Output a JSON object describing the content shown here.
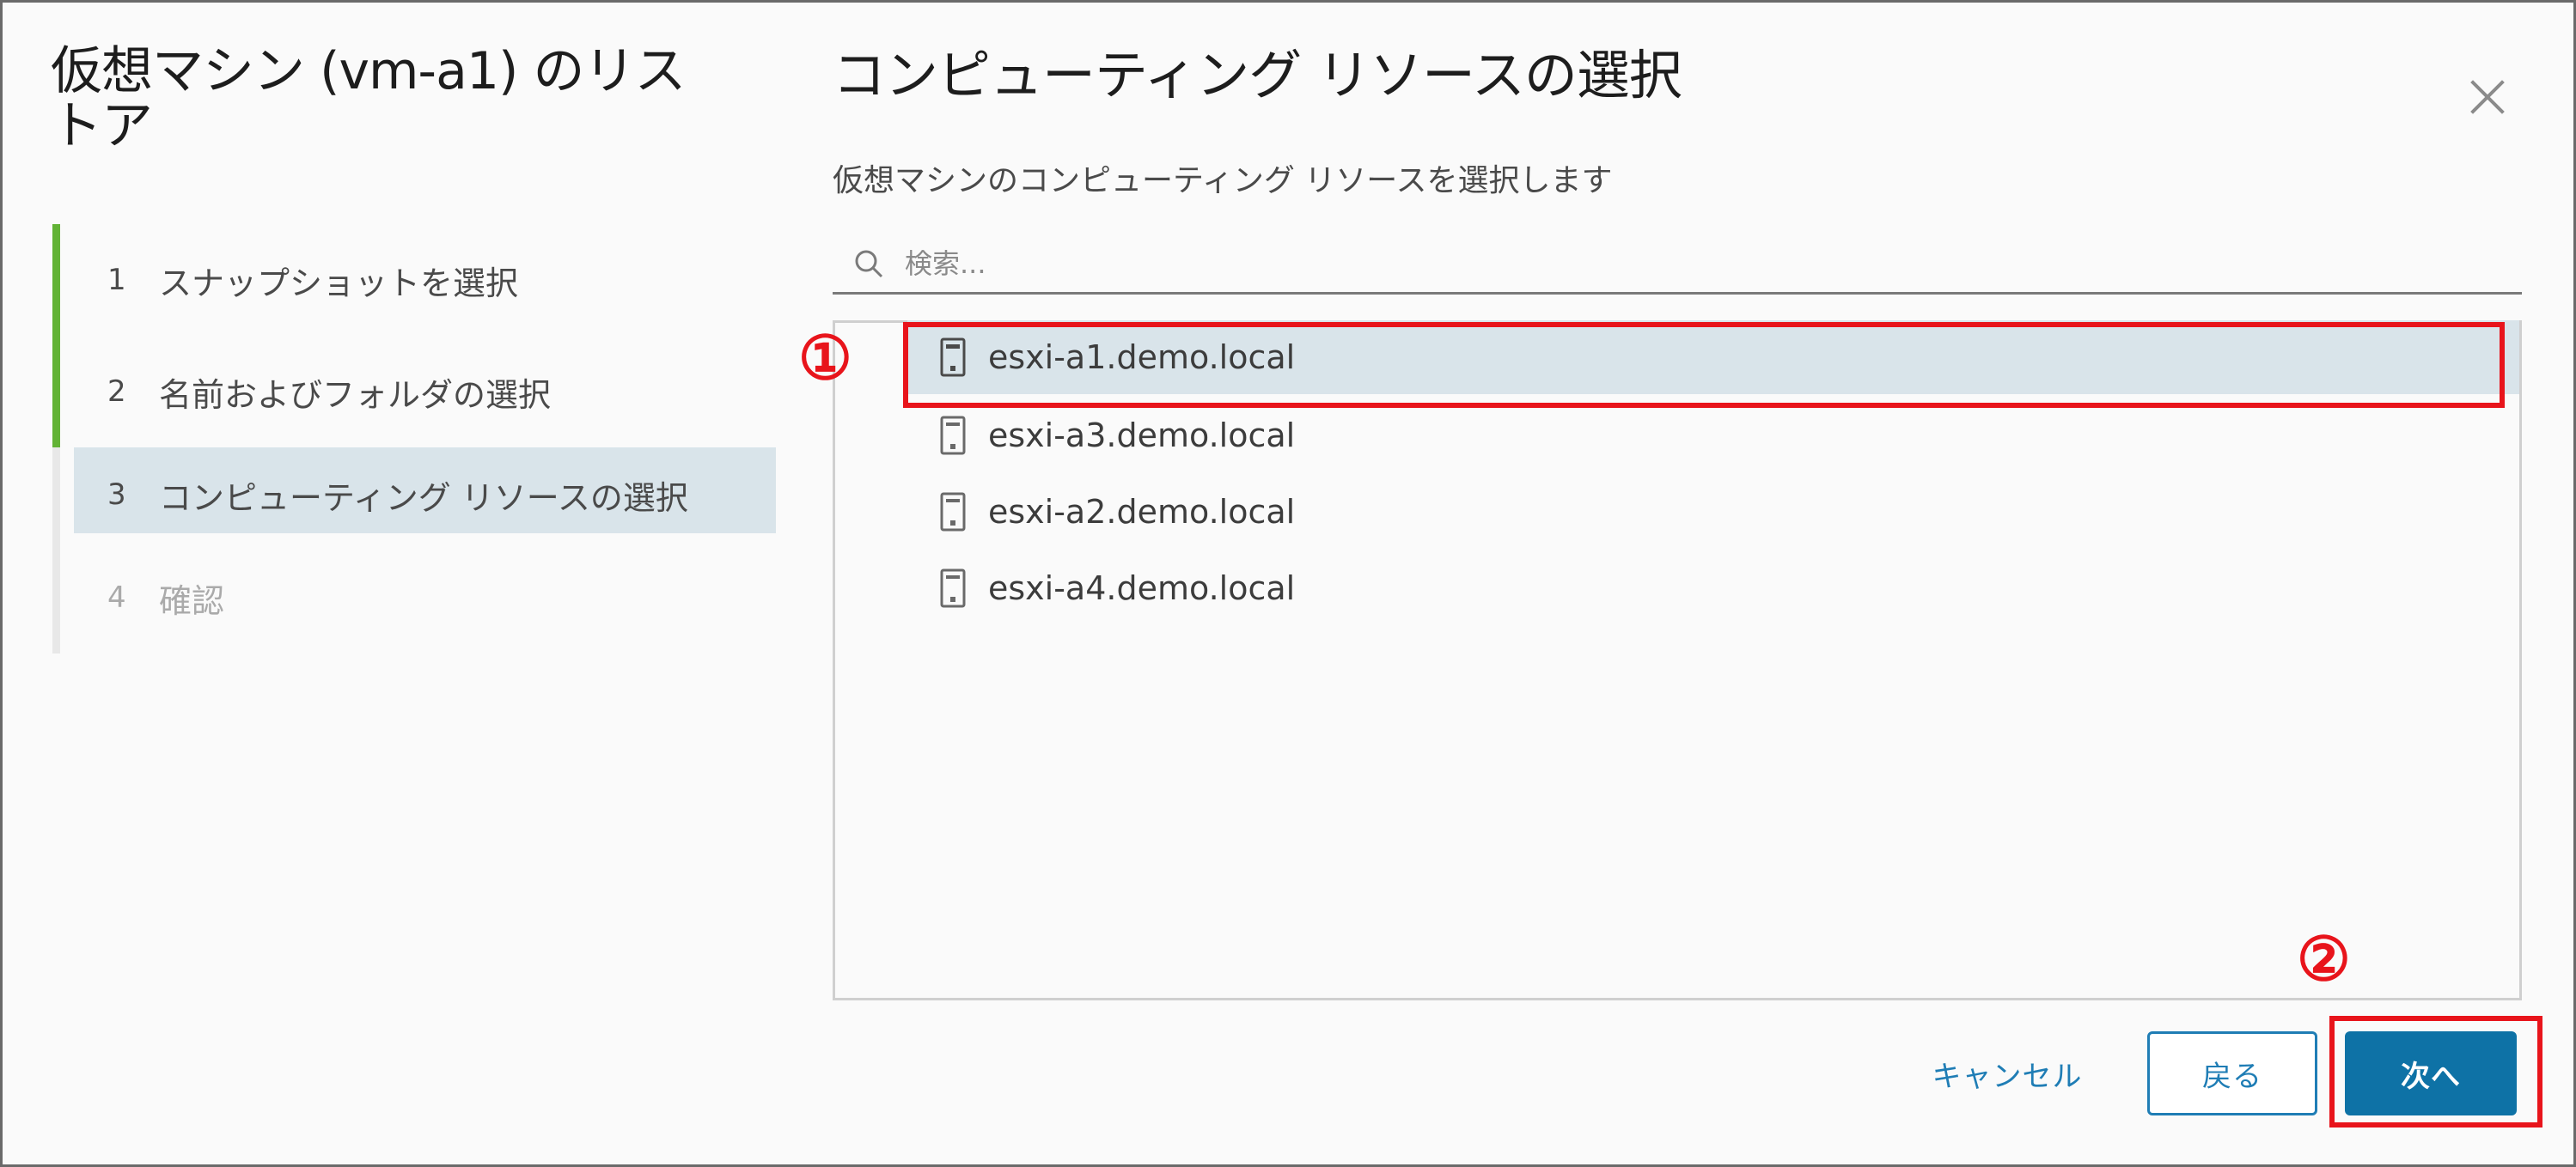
{
  "wizard": {
    "title": "仮想マシン (vm-a1) のリストア",
    "steps": [
      {
        "num": "1",
        "label": "スナップショットを選択"
      },
      {
        "num": "2",
        "label": "名前およびフォルダの選択"
      },
      {
        "num": "3",
        "label": "コンピューティング リソースの選択"
      },
      {
        "num": "4",
        "label": "確認"
      }
    ]
  },
  "content": {
    "title": "コンピューティング リソースの選択",
    "subtitle": "仮想マシンのコンピューティング リソースを選択します",
    "search": {
      "placeholder": "検索..."
    },
    "hosts": [
      {
        "label": "esxi-a1.demo.local",
        "selected": true
      },
      {
        "label": "esxi-a3.demo.local",
        "selected": false
      },
      {
        "label": "esxi-a2.demo.local",
        "selected": false
      },
      {
        "label": "esxi-a4.demo.local",
        "selected": false
      }
    ]
  },
  "annotations": {
    "marker1": "①",
    "marker2": "②"
  },
  "footer": {
    "cancel_label": "キャンセル",
    "back_label": "戻る",
    "next_label": "次へ"
  },
  "colors": {
    "progress_green": "#62b335",
    "selection_bg": "#d9e4ea",
    "primary_blue": "#0e72a6",
    "annotation_red": "#e8141b"
  }
}
